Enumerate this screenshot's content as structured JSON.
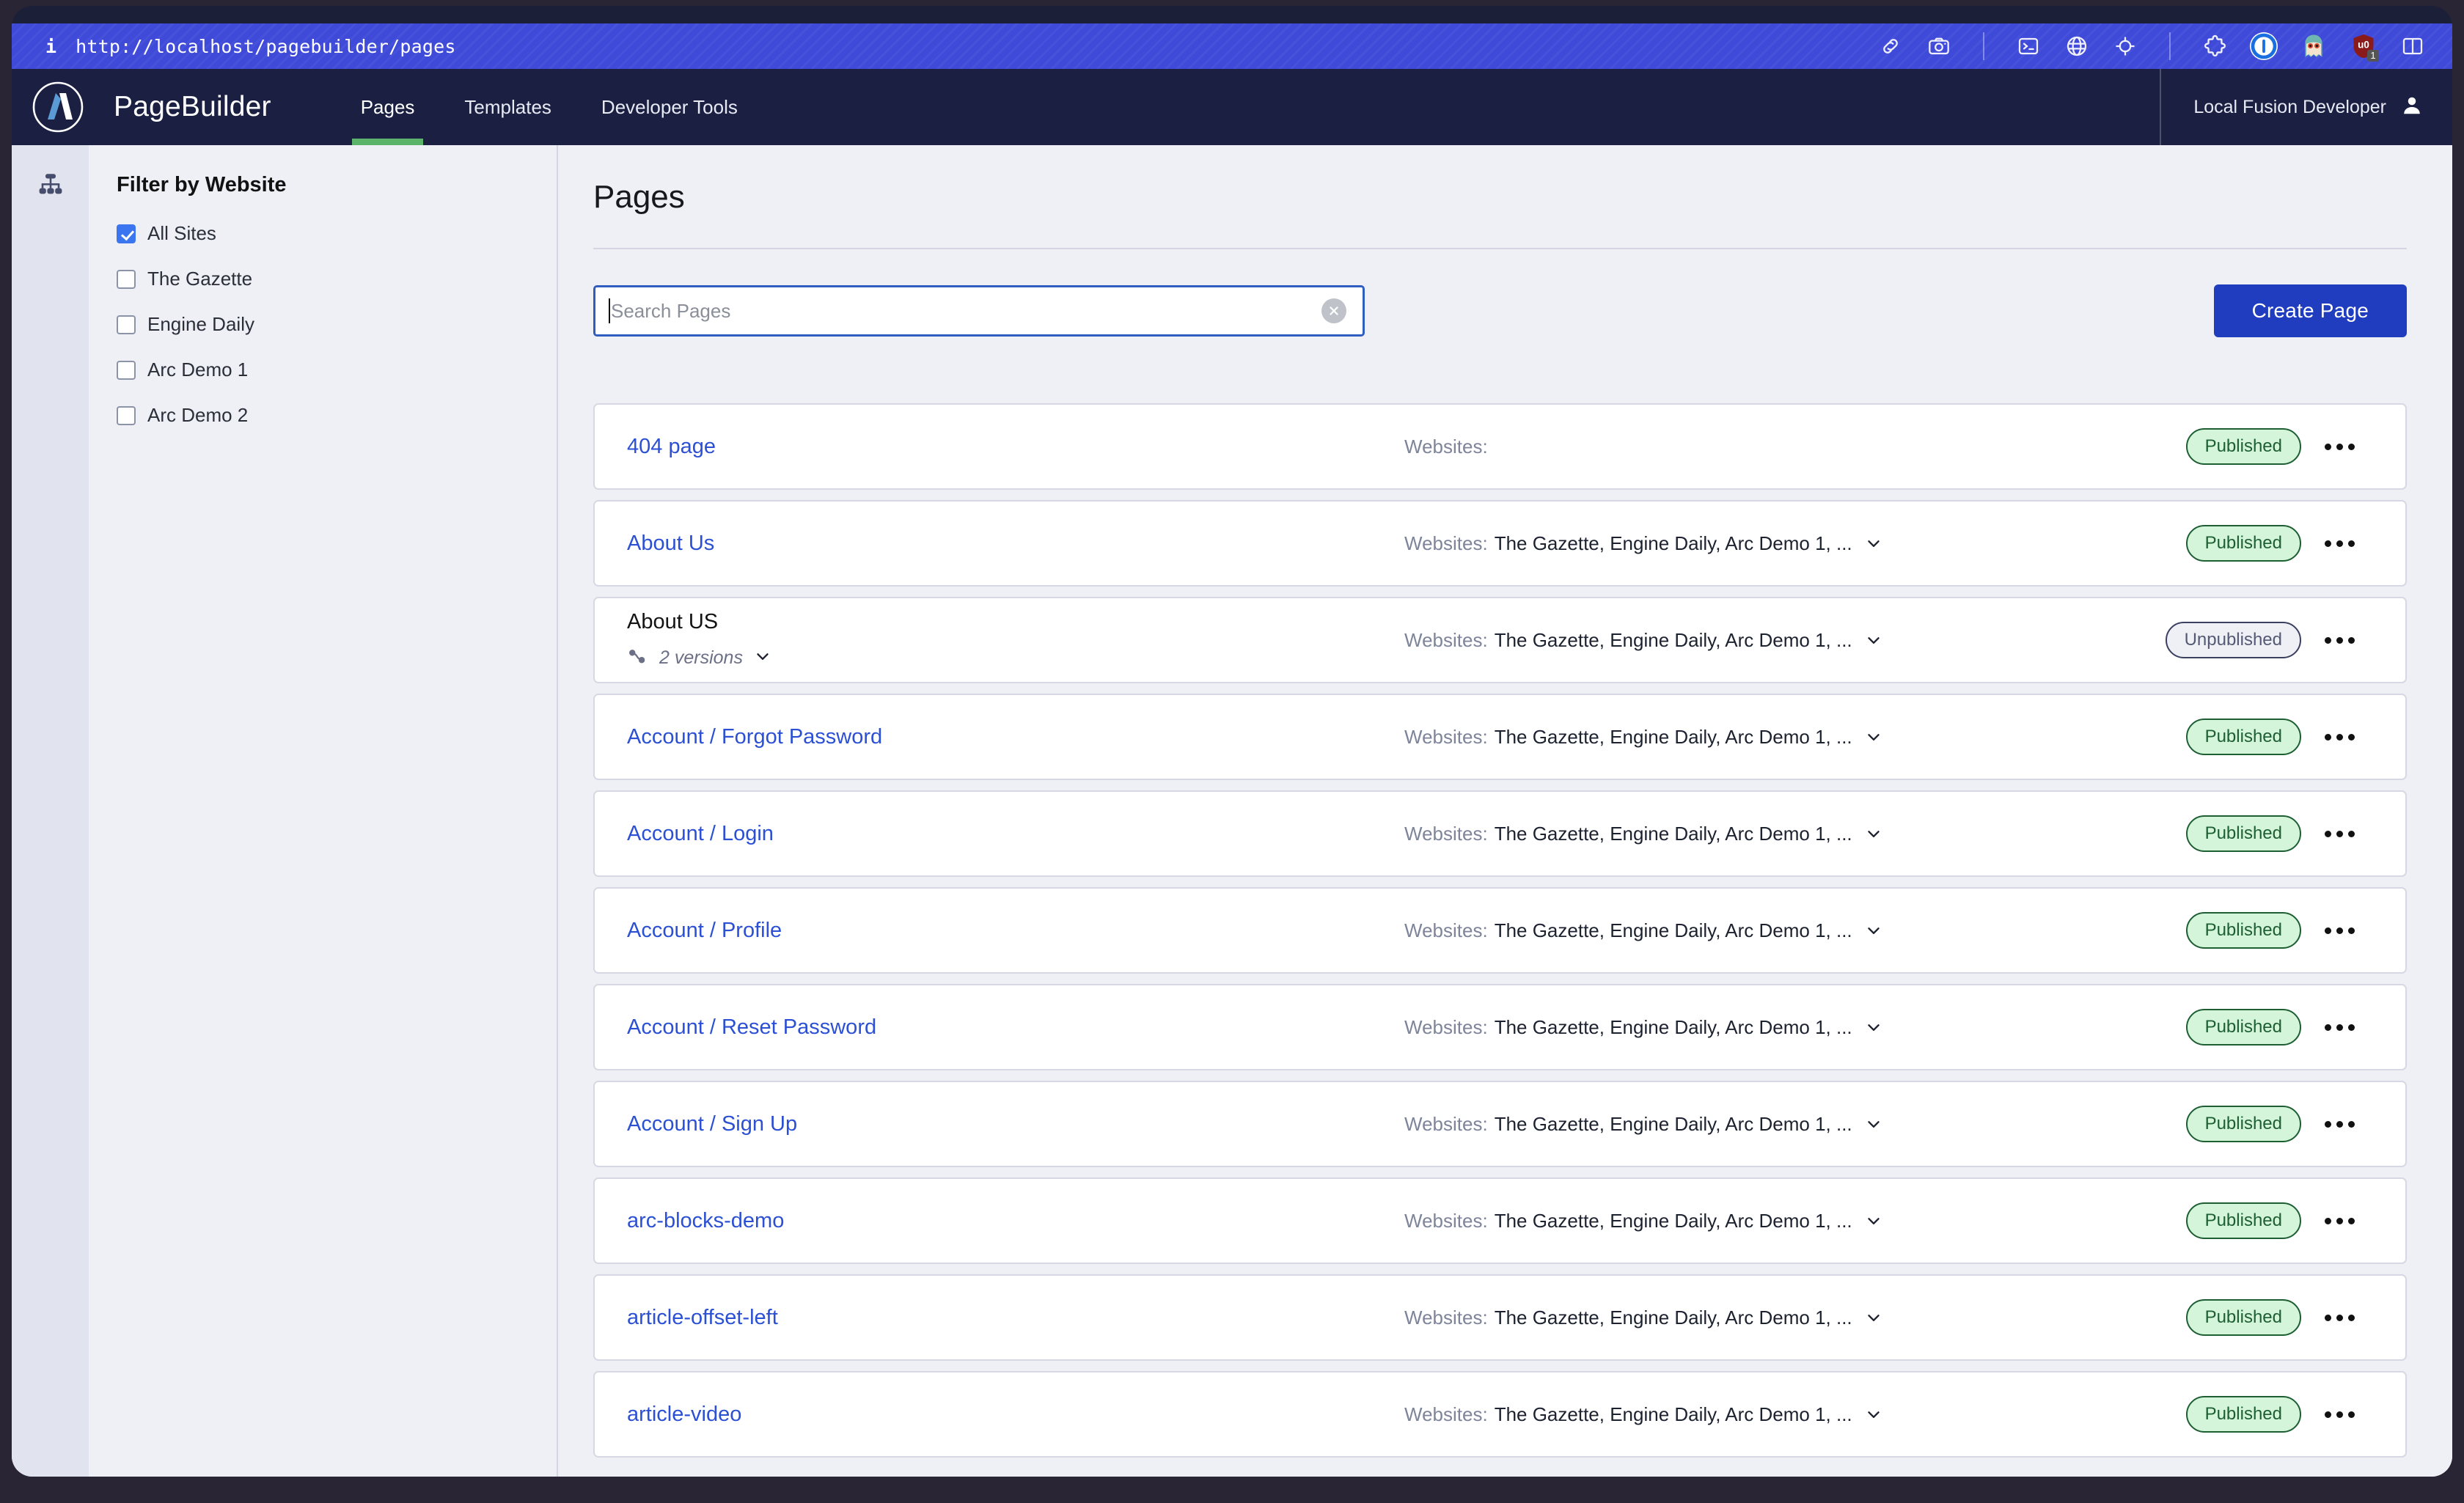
{
  "browser": {
    "url": "http://localhost/pagebuilder/pages",
    "info_icon": "info-icon",
    "toolbar_icons": [
      {
        "name": "link-icon"
      },
      {
        "name": "camera-icon"
      },
      {
        "name": "terminal-icon"
      },
      {
        "name": "globe-icon"
      },
      {
        "name": "crosshair-icon"
      },
      {
        "name": "puzzle-extension-icon"
      },
      {
        "name": "onepassword-extension-icon"
      },
      {
        "name": "ghostery-extension-icon"
      },
      {
        "name": "ublock-extension-icon",
        "badge": "1"
      },
      {
        "name": "split-view-icon"
      }
    ]
  },
  "header": {
    "logo": "arc-logo-icon",
    "title": "PageBuilder",
    "nav": [
      {
        "label": "Pages",
        "active": true
      },
      {
        "label": "Templates",
        "active": false
      },
      {
        "label": "Developer Tools",
        "active": false
      }
    ],
    "user": "Local Fusion Developer",
    "user_icon": "user-avatar-icon",
    "accent_color": "#5cb46a",
    "bg_color": "#1b2043"
  },
  "rail": {
    "icon": "sitemap-icon"
  },
  "sidebar": {
    "title": "Filter by Website",
    "items": [
      {
        "label": "All Sites",
        "checked": true
      },
      {
        "label": "The Gazette",
        "checked": false
      },
      {
        "label": "Engine Daily",
        "checked": false
      },
      {
        "label": "Arc Demo 1",
        "checked": false
      },
      {
        "label": "Arc Demo 2",
        "checked": false
      }
    ]
  },
  "main": {
    "page_title": "Pages",
    "search": {
      "placeholder": "Search Pages",
      "value": "",
      "clear_icon": "clear-circle-icon"
    },
    "create_button": "Create Page",
    "primary_color": "#1f3dbe",
    "sites_label": "Websites:",
    "sites_value": "The Gazette, Engine Daily, Arc Demo 1, ...",
    "rows": [
      {
        "name": "404 page",
        "link": true,
        "sites": "",
        "has_caret": false,
        "status": "Published",
        "versions": null
      },
      {
        "name": "About Us",
        "link": true,
        "sites": "The Gazette, Engine Daily, Arc Demo 1, ...",
        "has_caret": true,
        "status": "Published",
        "versions": null
      },
      {
        "name": "About US",
        "link": false,
        "sites": "The Gazette, Engine Daily, Arc Demo 1, ...",
        "has_caret": true,
        "status": "Unpublished",
        "versions": "2 versions"
      },
      {
        "name": "Account / Forgot Password",
        "link": true,
        "sites": "The Gazette, Engine Daily, Arc Demo 1, ...",
        "has_caret": true,
        "status": "Published",
        "versions": null
      },
      {
        "name": "Account / Login",
        "link": true,
        "sites": "The Gazette, Engine Daily, Arc Demo 1, ...",
        "has_caret": true,
        "status": "Published",
        "versions": null
      },
      {
        "name": "Account / Profile",
        "link": true,
        "sites": "The Gazette, Engine Daily, Arc Demo 1, ...",
        "has_caret": true,
        "status": "Published",
        "versions": null
      },
      {
        "name": "Account / Reset Password",
        "link": true,
        "sites": "The Gazette, Engine Daily, Arc Demo 1, ...",
        "has_caret": true,
        "status": "Published",
        "versions": null
      },
      {
        "name": "Account / Sign Up",
        "link": true,
        "sites": "The Gazette, Engine Daily, Arc Demo 1, ...",
        "has_caret": true,
        "status": "Published",
        "versions": null
      },
      {
        "name": "arc-blocks-demo",
        "link": true,
        "sites": "The Gazette, Engine Daily, Arc Demo 1, ...",
        "has_caret": true,
        "status": "Published",
        "versions": null
      },
      {
        "name": "article-offset-left",
        "link": true,
        "sites": "The Gazette, Engine Daily, Arc Demo 1, ...",
        "has_caret": true,
        "status": "Published",
        "versions": null
      },
      {
        "name": "article-video",
        "link": true,
        "sites": "The Gazette, Engine Daily, Arc Demo 1, ...",
        "has_caret": true,
        "status": "Published",
        "versions": null
      }
    ]
  }
}
